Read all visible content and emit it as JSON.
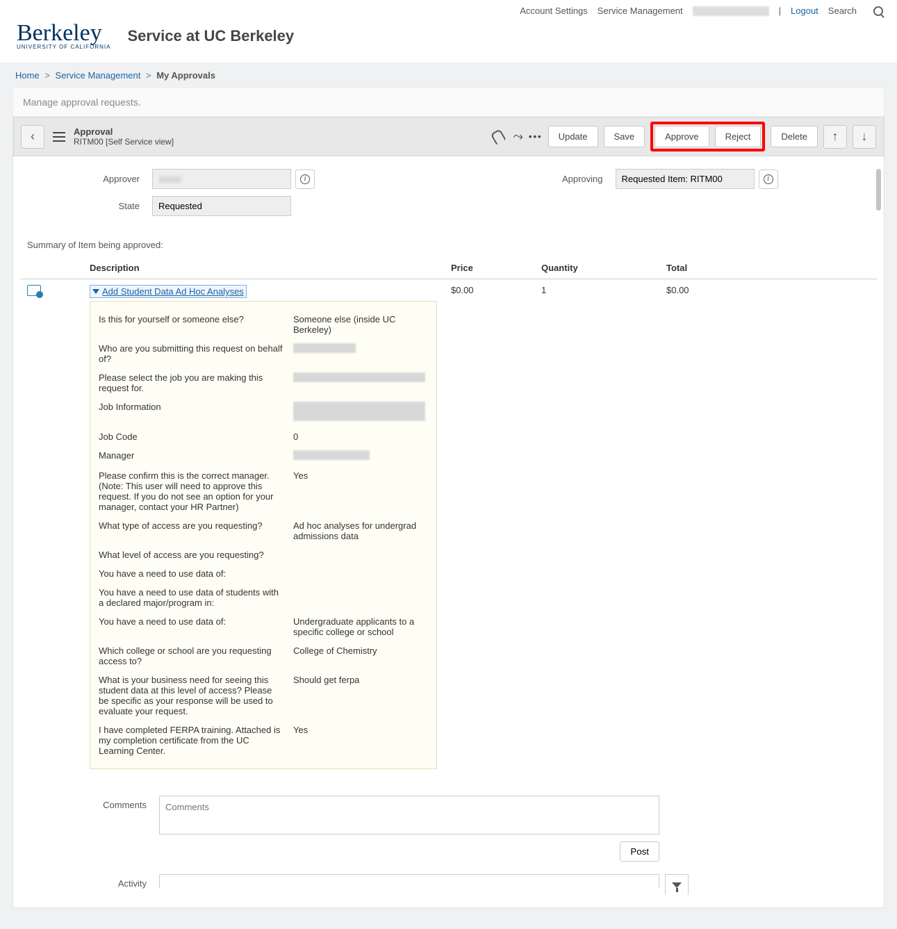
{
  "topbar": {
    "account": "Account Settings",
    "service": "Service Management",
    "logout": "Logout",
    "search": "Search"
  },
  "header": {
    "logo": "Berkeley",
    "logo_sub": "UNIVERSITY OF CALIFORNIA",
    "title": "Service at UC Berkeley"
  },
  "breadcrumb": {
    "home": "Home",
    "svc": "Service Management",
    "current": "My Approvals"
  },
  "subheader": "Manage approval requests.",
  "toolbar": {
    "title": "Approval",
    "sub": "RITM00          [Self Service view]",
    "update": "Update",
    "save": "Save",
    "approve": "Approve",
    "reject": "Reject",
    "delete": "Delete"
  },
  "form": {
    "approver_label": "Approver",
    "state_label": "State",
    "state_value": "Requested",
    "approving_label": "Approving",
    "approving_value": "Requested Item: RITM00"
  },
  "summary": {
    "title": "Summary of Item being approved:",
    "cols": {
      "desc": "Description",
      "price": "Price",
      "qty": "Quantity",
      "total": "Total"
    },
    "row": {
      "link": "Add Student Data Ad Hoc Analyses",
      "price": "$0.00",
      "qty": "1",
      "total": "$0.00"
    },
    "details": [
      {
        "q": "Is this for yourself or someone else?",
        "a": "Someone else (inside UC Berkeley)"
      },
      {
        "q": "Who are you submitting this request on behalf of?",
        "a": "",
        "redact": 90
      },
      {
        "q": "Please select the job you are making this request for.",
        "a": "",
        "redact": 190
      },
      {
        "q": "Job Information",
        "a": "",
        "redact": 190,
        "tall": true
      },
      {
        "q": "Job Code",
        "a": "0"
      },
      {
        "q": "Manager",
        "a": "",
        "redact": 110
      },
      {
        "q": "Please confirm this is the correct manager. (Note: This user will need to approve this request. If you do not see an option for your manager, contact your HR Partner)",
        "a": "Yes"
      },
      {
        "q": "What type of access are you requesting?",
        "a": "Ad hoc analyses for undergrad admissions data"
      },
      {
        "q": "What level of access are you requesting?",
        "a": ""
      },
      {
        "q": "You have a need to use data of:",
        "a": ""
      },
      {
        "q": "You have a need to use data of students with a declared major/program in:",
        "a": ""
      },
      {
        "q": "You have a need to use data of:",
        "a": "Undergraduate applicants to a specific college or school"
      },
      {
        "q": "Which college or school are you requesting access to?",
        "a": "College of Chemistry"
      },
      {
        "q": "What is your business need for seeing this student data at this level of access? Please be specific as your response will be used to evaluate your request.",
        "a": "Should get ferpa"
      },
      {
        "q": "I have completed FERPA training. Attached is my completion certificate from the UC Learning Center.",
        "a": "Yes"
      }
    ]
  },
  "comments": {
    "label": "Comments",
    "placeholder": "Comments",
    "post": "Post"
  },
  "activity": {
    "label": "Activity"
  }
}
